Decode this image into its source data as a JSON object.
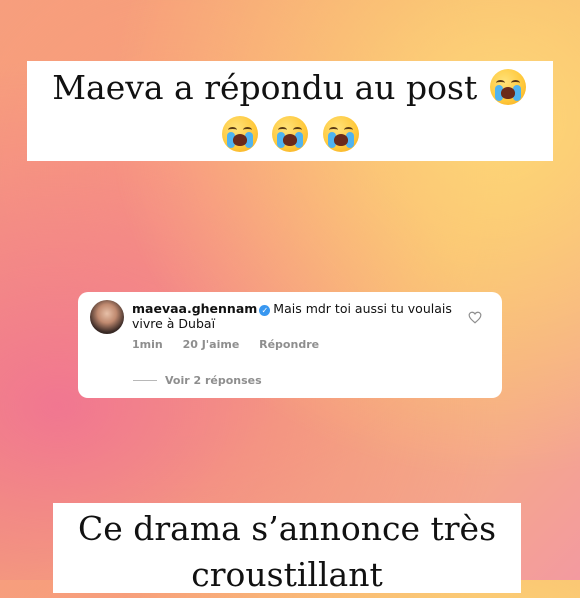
{
  "caption_top": {
    "line1": "Maeva a répondu au post",
    "emoji_name": "loudly-crying-face"
  },
  "comment": {
    "username": "maevaa.ghennam",
    "text": "Mais mdr toi aussi tu voulais vivre à Dubaï",
    "time": "1min",
    "likes": "20 J'aime",
    "reply_label": "Répondre",
    "view_replies": "Voir 2 réponses",
    "verified_color": "#3897f0"
  },
  "caption_bottom": {
    "text": "Ce drama s’annonce très croustillant"
  }
}
